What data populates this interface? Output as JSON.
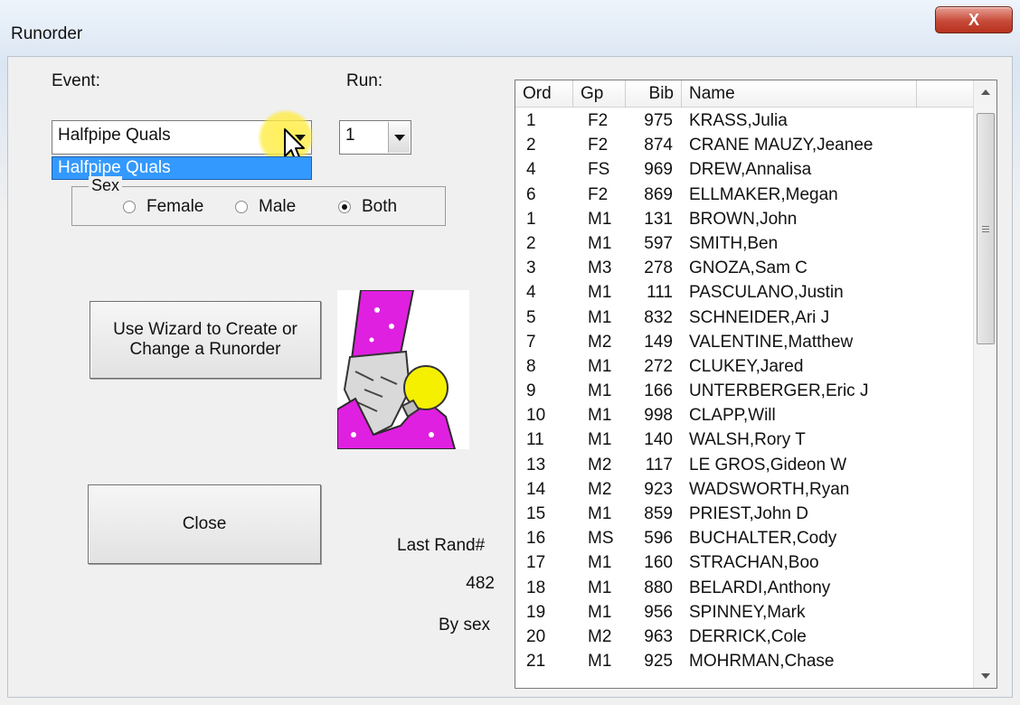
{
  "window": {
    "title": "Runorder",
    "close_glyph": "X"
  },
  "event": {
    "label": "Event:",
    "selected": "Halfpipe Quals",
    "dropdown_items": [
      "Halfpipe Quals"
    ]
  },
  "run": {
    "label": "Run:",
    "selected": "1"
  },
  "sex": {
    "group_label": "Sex",
    "options": [
      "Female",
      "Male",
      "Both"
    ],
    "selected": "Both"
  },
  "buttons": {
    "wizard_line1": "Use Wizard to Create or",
    "wizard_line2": "Change a Runorder",
    "close": "Close"
  },
  "info": {
    "last_rand_label": "Last Rand#",
    "last_rand_value": "482",
    "sort_mode": "By sex"
  },
  "table": {
    "columns": [
      "Ord",
      "Gp",
      "Bib",
      "Name"
    ],
    "rows": [
      [
        "1",
        "F2",
        "975",
        "KRASS,Julia"
      ],
      [
        "2",
        "F2",
        "874",
        "CRANE MAUZY,Jeanee"
      ],
      [
        "4",
        "FS",
        "969",
        "DREW,Annalisa"
      ],
      [
        "6",
        "F2",
        "869",
        "ELLMAKER,Megan"
      ],
      [
        "1",
        "M1",
        "131",
        "BROWN,John"
      ],
      [
        "2",
        "M1",
        "597",
        "SMITH,Ben"
      ],
      [
        "3",
        "M3",
        "278",
        "GNOZA,Sam C"
      ],
      [
        "4",
        "M1",
        "111",
        "PASCULANO,Justin"
      ],
      [
        "5",
        "M1",
        "832",
        "SCHNEIDER,Ari J"
      ],
      [
        "7",
        "M2",
        "149",
        "VALENTINE,Matthew"
      ],
      [
        "8",
        "M1",
        "272",
        "CLUKEY,Jared"
      ],
      [
        "9",
        "M1",
        "166",
        "UNTERBERGER,Eric J"
      ],
      [
        "10",
        "M1",
        "998",
        "CLAPP,Will"
      ],
      [
        "11",
        "M1",
        "140",
        "WALSH,Rory T"
      ],
      [
        "13",
        "M2",
        "117",
        "LE GROS,Gideon W"
      ],
      [
        "14",
        "M2",
        "923",
        "WADSWORTH,Ryan"
      ],
      [
        "15",
        "M1",
        "859",
        "PRIEST,John D"
      ],
      [
        "16",
        "MS",
        "596",
        "BUCHALTER,Cody"
      ],
      [
        "17",
        "M1",
        "160",
        "STRACHAN,Boo"
      ],
      [
        "18",
        "M1",
        "880",
        "BELARDI,Anthony"
      ],
      [
        "19",
        "M1",
        "956",
        "SPINNEY,Mark"
      ],
      [
        "20",
        "M2",
        "963",
        "DERRICK,Cole"
      ],
      [
        "21",
        "M1",
        "925",
        "MOHRMAN,Chase"
      ]
    ]
  },
  "icons": {
    "wizard_image": "wizard-with-crystal-ball-icon",
    "cursor": "mouse-pointer-icon"
  },
  "colors": {
    "selection": "#3399ff",
    "close_button": "#c74a38",
    "wizard_robe": "#e020e0",
    "crystal_ball": "#f5f000"
  }
}
